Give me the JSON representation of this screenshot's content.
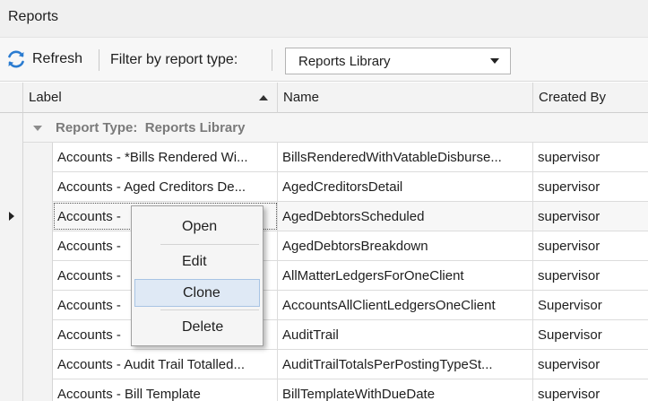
{
  "window": {
    "title": "Reports"
  },
  "toolbar": {
    "refresh_label": "Refresh",
    "filter_label": "Filter by report type:",
    "filter_value": "Reports Library"
  },
  "grid": {
    "columns": [
      "Label",
      "Name",
      "Created By"
    ],
    "group": {
      "label": "Report Type:",
      "value": "Reports Library"
    },
    "rows": [
      {
        "label": "Accounts - *Bills Rendered Wi...",
        "name": "BillsRenderedWithVatableDisburse...",
        "created_by": "supervisor"
      },
      {
        "label": "Accounts - Aged Creditors De...",
        "name": "AgedCreditorsDetail",
        "created_by": "supervisor"
      },
      {
        "label": "Accounts - ",
        "name": "AgedDebtorsScheduled",
        "created_by": "supervisor"
      },
      {
        "label": "Accounts - ",
        "name": "AgedDebtorsBreakdown",
        "created_by": "supervisor"
      },
      {
        "label": "Accounts - ",
        "name": "AllMatterLedgersForOneClient",
        "created_by": "supervisor"
      },
      {
        "label": "Accounts - ",
        "name": "AccountsAllClientLedgersOneClient",
        "created_by": "Supervisor"
      },
      {
        "label": "Accounts - ",
        "name": "AuditTrail",
        "created_by": "Supervisor"
      },
      {
        "label": "Accounts - Audit Trail Totalled...",
        "name": "AuditTrailTotalsPerPostingTypeSt...",
        "created_by": "supervisor"
      },
      {
        "label": "Accounts - Bill Template",
        "name": "BillTemplateWithDueDate",
        "created_by": "supervisor"
      }
    ]
  },
  "context_menu": {
    "items": [
      "Open",
      "Edit",
      "Clone",
      "Delete"
    ]
  },
  "colors": {
    "menu_hover": "#dfe9f5",
    "menu_hover_border": "#a8c4e4",
    "refresh_icon_blue": "#2a7bd0"
  }
}
